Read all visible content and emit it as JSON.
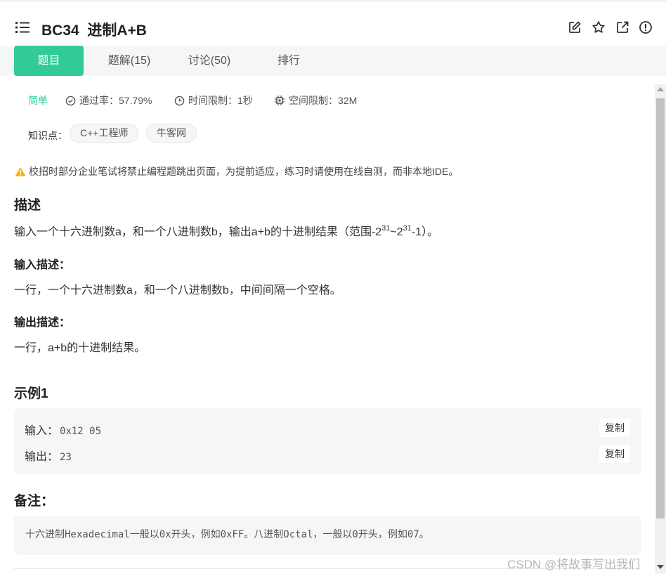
{
  "header": {
    "title": "BC34  进制A+B",
    "icons": [
      "edit-icon",
      "star-icon",
      "external-link-icon",
      "info-icon"
    ]
  },
  "tabs": [
    {
      "label": "题目",
      "active": true
    },
    {
      "label": "题解(15)",
      "active": false
    },
    {
      "label": "讨论(50)",
      "active": false
    },
    {
      "label": "排行",
      "active": false
    }
  ],
  "meta": {
    "difficulty": "简单",
    "pass_rate": "通过率：57.79%",
    "time_limit": "时间限制：1秒",
    "space_limit": "空间限制：32M"
  },
  "knowledge": {
    "label": "知识点：",
    "tags": [
      "C++工程师",
      "牛客网"
    ]
  },
  "warning": "校招时部分企业笔试将禁止编程题跳出页面，为提前适应，练习时请使用在线自测，而非本地IDE。",
  "description": {
    "heading": "描述",
    "text_prefix": "输入一个十六进制数a，和一个八进制数b，输出a+b的十进制结果（范围-2",
    "exp1": "31",
    "text_mid": "~2",
    "exp2": "31",
    "text_suffix": "-1）。"
  },
  "input_desc": {
    "heading": "输入描述：",
    "text": "一行，一个十六进制数a，和一个八进制数b，中间间隔一个空格。"
  },
  "output_desc": {
    "heading": "输出描述：",
    "text": "一行，a+b的十进制结果。"
  },
  "example": {
    "heading": "示例1",
    "input_label": "输入：",
    "input_value": "0x12 05",
    "output_label": "输出：",
    "output_value": "23",
    "copy_label": "复制"
  },
  "note": {
    "heading": "备注：",
    "text": "十六进制Hexadecimal一般以0x开头，例如0xFF。八进制Octal，一般以0开头，例如07。"
  },
  "watermark": "CSDN @将故事写出我们",
  "colors": {
    "accent": "#32ca99",
    "tab_bar_bg": "#f5f6f8",
    "warning_icon": "#f5b400"
  }
}
